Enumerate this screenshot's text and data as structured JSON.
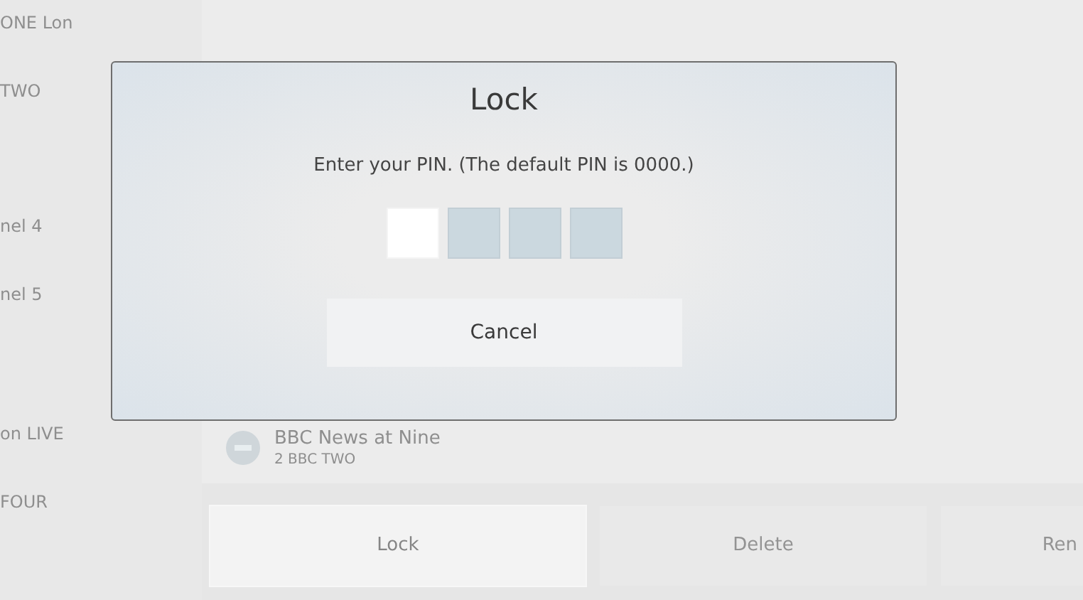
{
  "channel_list": [
    {
      "label": "ONE Lon"
    },
    {
      "label": "TWO"
    },
    {
      "label": "nel 4"
    },
    {
      "label": "nel 5"
    },
    {
      "label": "on LIVE"
    },
    {
      "label": "FOUR"
    }
  ],
  "programme": {
    "title": "BBC News at Nine",
    "channel": "2  BBC TWO"
  },
  "actions": [
    {
      "label": "Lock",
      "selected": true
    },
    {
      "label": "Delete",
      "selected": false
    },
    {
      "label": "Ren",
      "selected": false
    }
  ],
  "dialog": {
    "title": "Lock",
    "message": "Enter your PIN. (The default PIN is 0000.)",
    "pin_digits": [
      {
        "selected": true
      },
      {
        "selected": false
      },
      {
        "selected": false
      },
      {
        "selected": false
      }
    ],
    "buttons": [
      "Cancel"
    ]
  }
}
